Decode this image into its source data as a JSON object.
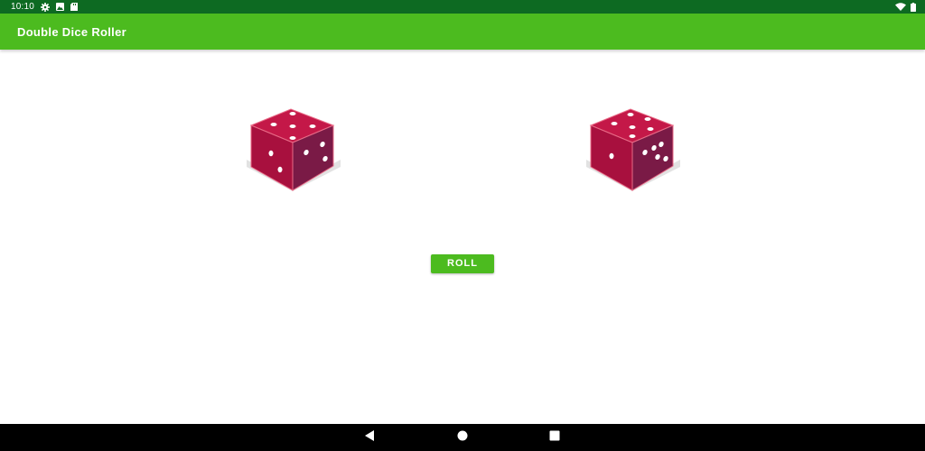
{
  "status_bar": {
    "time": "10:10",
    "left_icons": [
      "gear-icon",
      "photo-icon",
      "sd-card-icon"
    ],
    "right_icons": [
      "wifi-icon",
      "battery-icon"
    ]
  },
  "app_bar": {
    "title": "Double Dice Roller"
  },
  "dice": [
    {
      "name": "left-die",
      "top_face": 5,
      "left_face": 2,
      "right_face": 3
    },
    {
      "name": "right-die",
      "top_face": 6,
      "left_face": 1,
      "right_face": 5
    }
  ],
  "roll_button": {
    "label": "ROLL"
  },
  "nav_bar": {
    "buttons": [
      "back-icon",
      "home-icon",
      "recents-icon"
    ]
  },
  "colors": {
    "status_bar": "#0d6a22",
    "app_bar": "#4cbb1f",
    "accent": "#4cbb1f",
    "die_top": "#c41848",
    "die_left": "#a8103e",
    "die_right": "#7a1a46",
    "nav_bar": "#000000"
  }
}
